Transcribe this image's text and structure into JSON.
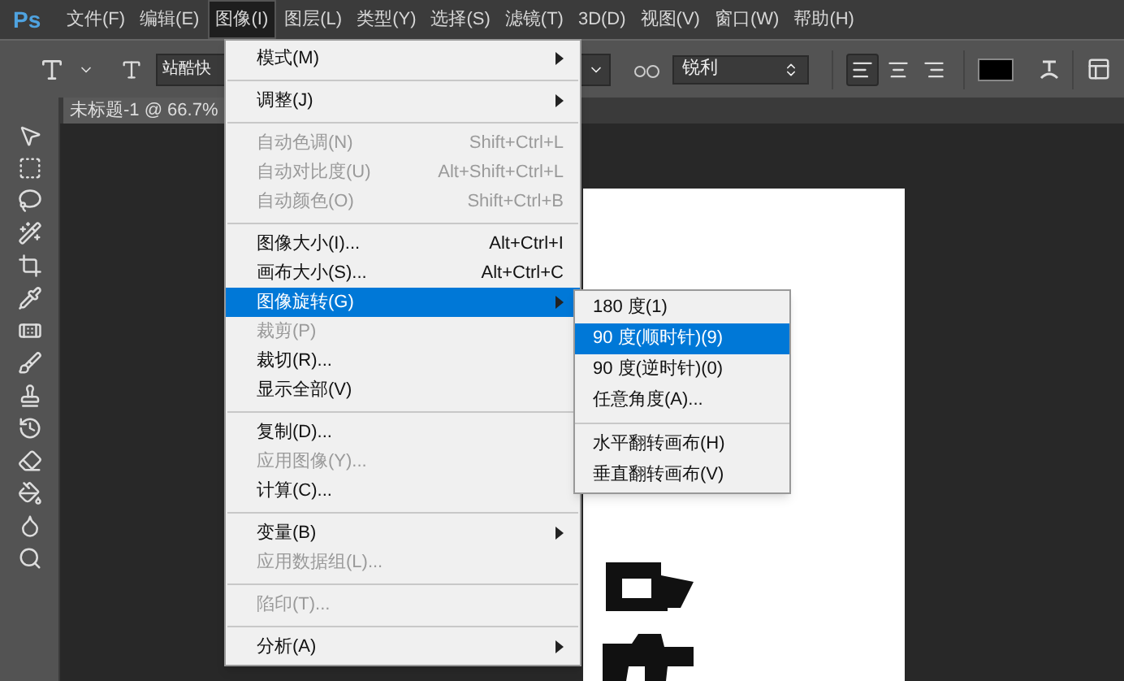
{
  "app": {
    "logo": "Ps"
  },
  "menubar": [
    {
      "label": "文件(F)",
      "selected": false
    },
    {
      "label": "编辑(E)",
      "selected": false
    },
    {
      "label": "图像(I)",
      "selected": true
    },
    {
      "label": "图层(L)",
      "selected": false
    },
    {
      "label": "类型(Y)",
      "selected": false
    },
    {
      "label": "选择(S)",
      "selected": false
    },
    {
      "label": "滤镜(T)",
      "selected": false
    },
    {
      "label": "3D(D)",
      "selected": false
    },
    {
      "label": "视图(V)",
      "selected": false
    },
    {
      "label": "窗口(W)",
      "selected": false
    },
    {
      "label": "帮助(H)",
      "selected": false
    }
  ],
  "options_bar": {
    "font_family": "站酷快",
    "antialias": "锐利",
    "alignment": [
      {
        "kind": "left",
        "selected": true
      },
      {
        "kind": "center",
        "selected": false
      },
      {
        "kind": "right",
        "selected": false
      }
    ]
  },
  "document_tab": {
    "title": "未标题-1 @ 66.7%"
  },
  "image_menu": [
    {
      "kind": "item",
      "label": "模式(M)",
      "submenu": true,
      "disabled": false,
      "selected": false
    },
    {
      "kind": "separator"
    },
    {
      "kind": "item",
      "label": "调整(J)",
      "submenu": true,
      "disabled": false,
      "selected": false
    },
    {
      "kind": "separator"
    },
    {
      "kind": "item",
      "label": "自动色调(N)",
      "shortcut": "Shift+Ctrl+L",
      "disabled": true,
      "selected": false
    },
    {
      "kind": "item",
      "label": "自动对比度(U)",
      "shortcut": "Alt+Shift+Ctrl+L",
      "disabled": true,
      "selected": false
    },
    {
      "kind": "item",
      "label": "自动颜色(O)",
      "shortcut": "Shift+Ctrl+B",
      "disabled": true,
      "selected": false
    },
    {
      "kind": "separator"
    },
    {
      "kind": "item",
      "label": "图像大小(I)...",
      "shortcut": "Alt+Ctrl+I",
      "disabled": false,
      "selected": false
    },
    {
      "kind": "item",
      "label": "画布大小(S)...",
      "shortcut": "Alt+Ctrl+C",
      "disabled": false,
      "selected": false
    },
    {
      "kind": "item",
      "label": "图像旋转(G)",
      "submenu": true,
      "disabled": false,
      "selected": true
    },
    {
      "kind": "item",
      "label": "裁剪(P)",
      "disabled": true,
      "selected": false
    },
    {
      "kind": "item",
      "label": "裁切(R)...",
      "disabled": false,
      "selected": false
    },
    {
      "kind": "item",
      "label": "显示全部(V)",
      "disabled": false,
      "selected": false
    },
    {
      "kind": "separator"
    },
    {
      "kind": "item",
      "label": "复制(D)...",
      "disabled": false,
      "selected": false
    },
    {
      "kind": "item",
      "label": "应用图像(Y)...",
      "disabled": true,
      "selected": false
    },
    {
      "kind": "item",
      "label": "计算(C)...",
      "disabled": false,
      "selected": false
    },
    {
      "kind": "separator"
    },
    {
      "kind": "item",
      "label": "变量(B)",
      "submenu": true,
      "disabled": false,
      "selected": false
    },
    {
      "kind": "item",
      "label": "应用数据组(L)...",
      "disabled": true,
      "selected": false
    },
    {
      "kind": "separator"
    },
    {
      "kind": "item",
      "label": "陷印(T)...",
      "disabled": true,
      "selected": false
    },
    {
      "kind": "separator"
    },
    {
      "kind": "item",
      "label": "分析(A)",
      "submenu": true,
      "disabled": false,
      "selected": false
    }
  ],
  "rotation_submenu": [
    {
      "kind": "item",
      "label": "180 度(1)",
      "selected": false
    },
    {
      "kind": "item",
      "label": "90 度(顺时针)(9)",
      "selected": true
    },
    {
      "kind": "item",
      "label": "90 度(逆时针)(0)",
      "selected": false
    },
    {
      "kind": "item",
      "label": "任意角度(A)...",
      "selected": false
    },
    {
      "kind": "separator"
    },
    {
      "kind": "item",
      "label": "水平翻转画布(H)",
      "selected": false
    },
    {
      "kind": "item",
      "label": "垂直翻转画布(V)",
      "selected": false
    }
  ]
}
